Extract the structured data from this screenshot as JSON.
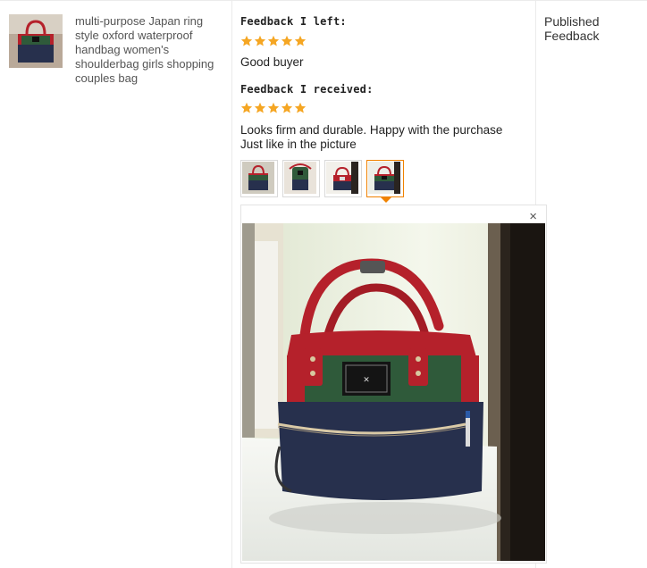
{
  "product": {
    "title": "multi-purpose Japan ring style oxford waterproof handbag women's shoulderbag girls shopping couples bag",
    "thumbnail_icon": "bag-photo"
  },
  "feedback_left": {
    "heading": "Feedback I left:",
    "rating": 5,
    "text": "Good buyer"
  },
  "feedback_received": {
    "heading": "Feedback I received:",
    "rating": 5,
    "text": "Looks firm and durable. Happy with the purchase Just like in the picture"
  },
  "photo_viewer": {
    "thumbnail_count": 4,
    "active_thumbnail": 4,
    "close_icon": "×"
  },
  "status": {
    "label": "Published Feedback"
  },
  "colors": {
    "star": "#f5a623",
    "active_border": "#f08200",
    "bag_red": "#b5212b",
    "bag_green": "#2f5a3a",
    "bag_navy": "#27304d"
  }
}
